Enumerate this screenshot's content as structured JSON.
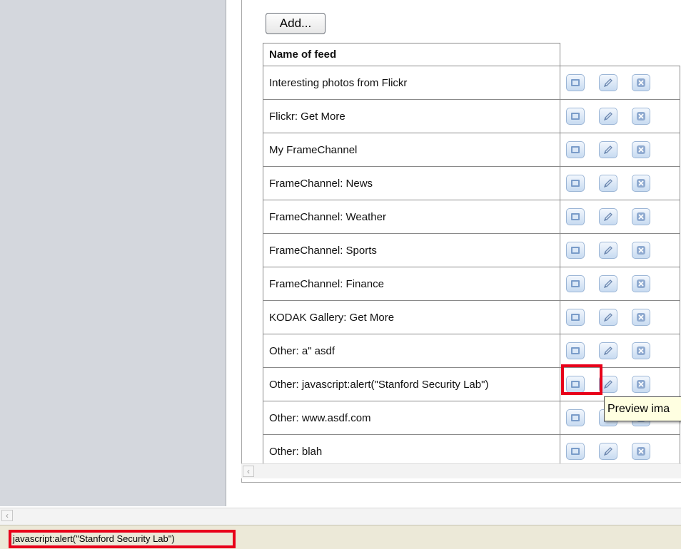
{
  "toolbar": {
    "add_label": "Add..."
  },
  "table": {
    "header": "Name of feed",
    "rows": [
      {
        "name": "Interesting photos from Flickr"
      },
      {
        "name": "Flickr: Get More"
      },
      {
        "name": "My FrameChannel"
      },
      {
        "name": "FrameChannel: News"
      },
      {
        "name": "FrameChannel: Weather"
      },
      {
        "name": "FrameChannel: Sports"
      },
      {
        "name": "FrameChannel: Finance"
      },
      {
        "name": "KODAK Gallery: Get More"
      },
      {
        "name": "Other: a\" asdf"
      },
      {
        "name": "Other: javascript:alert(\"Stanford Security Lab\")"
      },
      {
        "name": "Other: www.asdf.com"
      },
      {
        "name": "Other: blah"
      }
    ],
    "action_icons": [
      "preview-icon",
      "edit-pencil-icon",
      "delete-x-icon"
    ]
  },
  "tooltip": {
    "text": "Preview ima"
  },
  "status_bar": {
    "text": "javascript:alert(\"Stanford Security Lab\")"
  },
  "colors": {
    "highlight": "#e8001a",
    "button_blue": "#c8dbf1",
    "left_panel": "#d4d7dd"
  }
}
